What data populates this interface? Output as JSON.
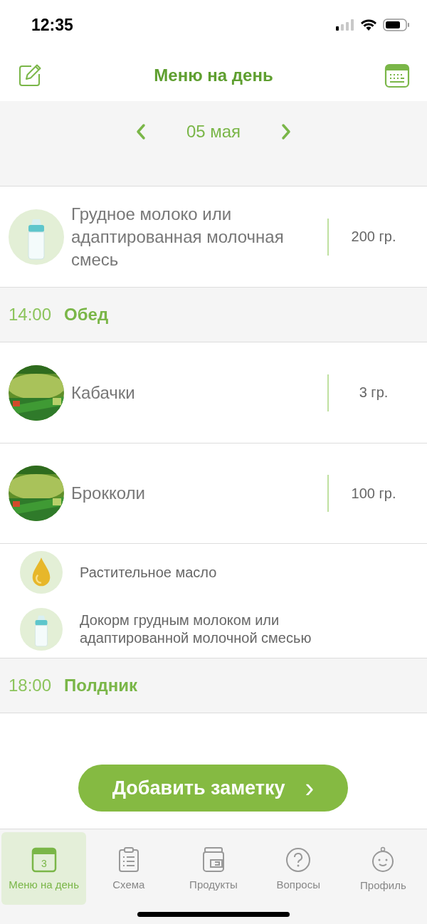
{
  "status_bar": {
    "time": "12:35"
  },
  "header": {
    "title": "Меню на день"
  },
  "date_bar": {
    "date": "05 мая"
  },
  "meals": [
    {
      "items": [
        {
          "kind": "formula",
          "name": "Грудное молоко или адаптированная молочная смесь",
          "amount": "200 гр."
        }
      ]
    },
    {
      "time": "14:00",
      "name": "Обед",
      "items": [
        {
          "kind": "puree",
          "name": "Кабачки",
          "amount": "3 гр."
        },
        {
          "kind": "puree",
          "name": "Брокколи",
          "amount": "100 гр."
        },
        {
          "kind": "oil",
          "name": "Растительное масло"
        },
        {
          "kind": "supplement",
          "name": "Докорм грудным молоком или адаптированной молочной смесью"
        }
      ]
    },
    {
      "time": "18:00",
      "name": "Полдник"
    }
  ],
  "add_button": {
    "label": "Добавить заметку",
    "arrow": "›"
  },
  "tabs": [
    {
      "label": "Меню на день",
      "badge": "3",
      "selected": true
    },
    {
      "label": "Схема",
      "selected": false
    },
    {
      "label": "Продукты",
      "selected": false
    },
    {
      "label": "Вопросы",
      "selected": false
    },
    {
      "label": "Профиль",
      "selected": false
    }
  ]
}
